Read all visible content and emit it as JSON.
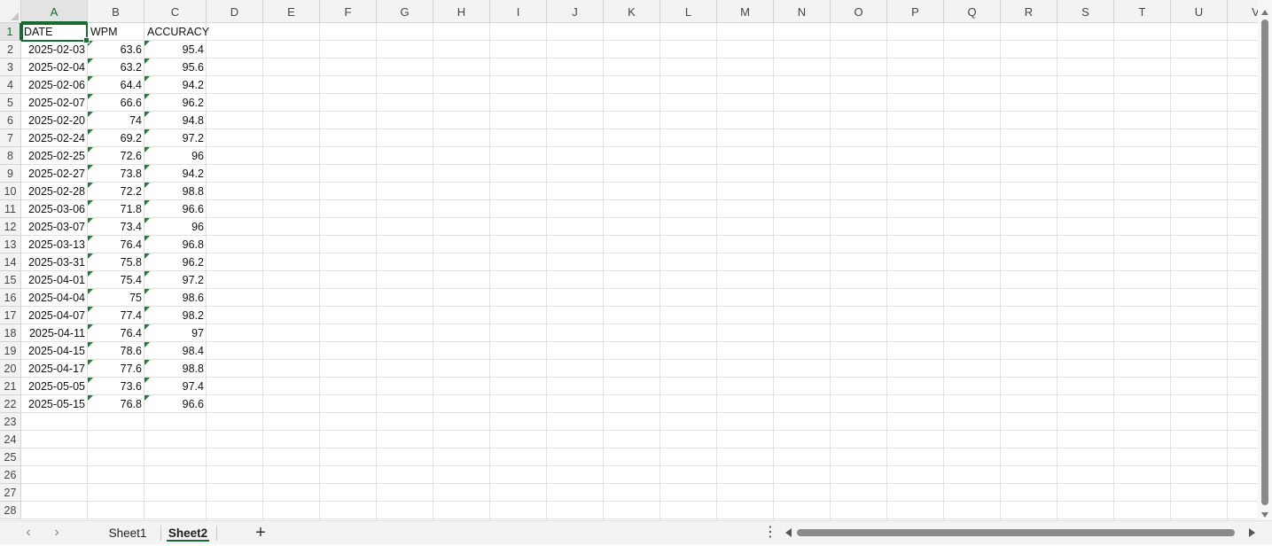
{
  "columns": [
    "A",
    "B",
    "C",
    "D",
    "E",
    "F",
    "G",
    "H",
    "I",
    "J",
    "K",
    "L",
    "M",
    "N",
    "O",
    "P",
    "Q",
    "R",
    "S",
    "T",
    "U",
    "V"
  ],
  "rows": [
    "1",
    "2",
    "3",
    "4",
    "5",
    "6",
    "7",
    "8",
    "9",
    "10",
    "11",
    "12",
    "13",
    "14",
    "15",
    "16",
    "17",
    "18",
    "19",
    "20",
    "21",
    "22",
    "23",
    "24",
    "25",
    "26",
    "27",
    "28"
  ],
  "selected_cell": "A1",
  "headers": [
    "DATE",
    "WPM",
    "ACCURACY"
  ],
  "records": [
    [
      "2025-02-03",
      "63.6",
      "95.4"
    ],
    [
      "2025-02-04",
      "63.2",
      "95.6"
    ],
    [
      "2025-02-06",
      "64.4",
      "94.2"
    ],
    [
      "2025-02-07",
      "66.6",
      "96.2"
    ],
    [
      "2025-02-20",
      "74",
      "94.8"
    ],
    [
      "2025-02-24",
      "69.2",
      "97.2"
    ],
    [
      "2025-02-25",
      "72.6",
      "96"
    ],
    [
      "2025-02-27",
      "73.8",
      "94.2"
    ],
    [
      "2025-02-28",
      "72.2",
      "98.8"
    ],
    [
      "2025-03-06",
      "71.8",
      "96.6"
    ],
    [
      "2025-03-07",
      "73.4",
      "96"
    ],
    [
      "2025-03-13",
      "76.4",
      "96.8"
    ],
    [
      "2025-03-31",
      "75.8",
      "96.2"
    ],
    [
      "2025-04-01",
      "75.4",
      "97.2"
    ],
    [
      "2025-04-04",
      "75",
      "98.6"
    ],
    [
      "2025-04-07",
      "77.4",
      "98.2"
    ],
    [
      "2025-04-11",
      "76.4",
      "97"
    ],
    [
      "2025-04-15",
      "78.6",
      "98.4"
    ],
    [
      "2025-04-17",
      "77.6",
      "98.8"
    ],
    [
      "2025-05-05",
      "73.6",
      "97.4"
    ],
    [
      "2025-05-15",
      "76.8",
      "96.6"
    ]
  ],
  "sheet_tabs": [
    {
      "label": "Sheet1",
      "active": false
    },
    {
      "label": "Sheet2",
      "active": true
    }
  ],
  "controls": {
    "prev_sheet_icon": "chevron-left-icon",
    "next_sheet_icon": "chevron-right-icon",
    "add_sheet_label": "+",
    "more_label": "⋮"
  },
  "colors": {
    "accent": "#146c2e",
    "error_flag": "#1e7d32",
    "header_bg": "#f3f3f3",
    "gridline": "#e1e1e1"
  }
}
